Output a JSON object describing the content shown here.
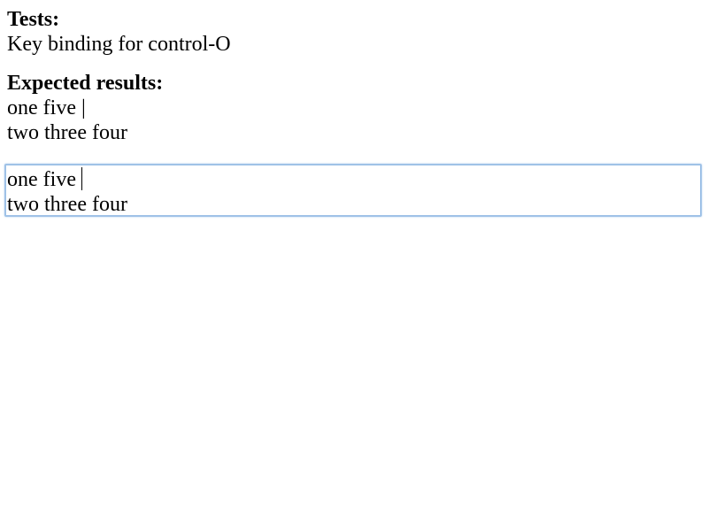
{
  "tests": {
    "title": "Tests:",
    "description": "Key binding for control-O"
  },
  "expected": {
    "title": "Expected results:",
    "line1": "one five |",
    "line2": "two three four"
  },
  "editor": {
    "line1": "one five",
    "line2": "two three four"
  }
}
